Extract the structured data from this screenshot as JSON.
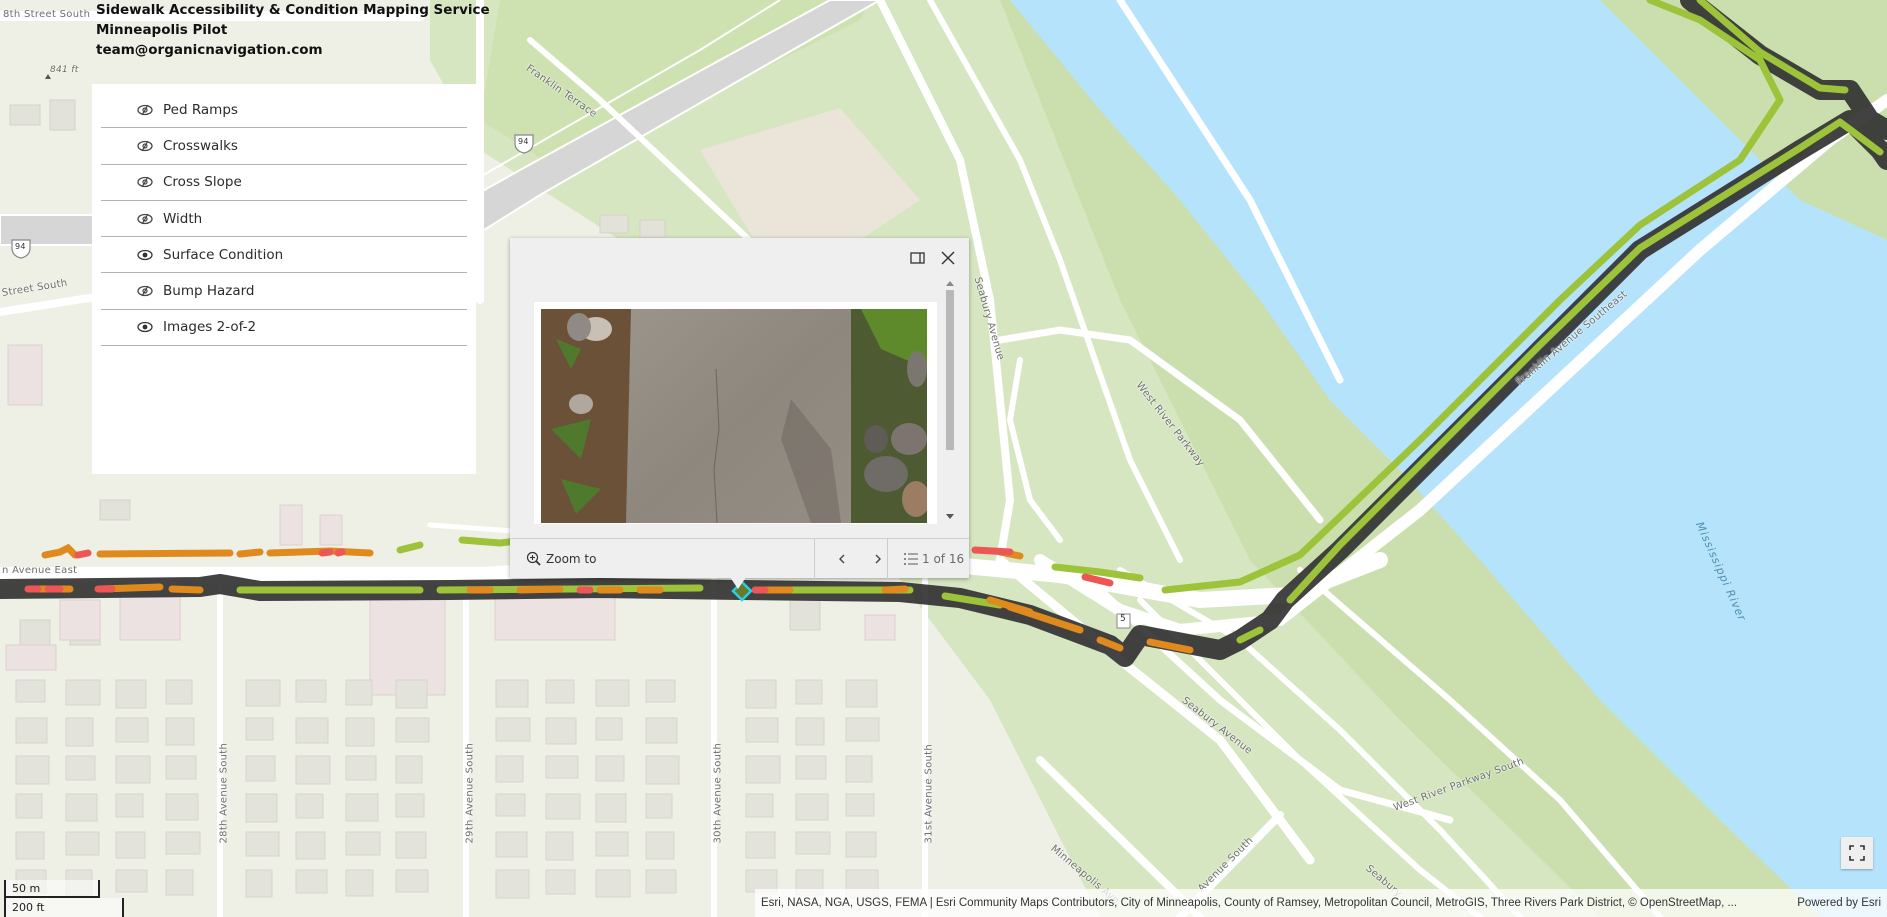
{
  "header": {
    "title": "Sidewalk Accessibility & Condition Mapping Service",
    "subtitle": "Minneapolis Pilot",
    "contact": "team@organicnavigation.com"
  },
  "layers": [
    {
      "label": "Ped Ramps",
      "visible": false
    },
    {
      "label": "Crosswalks",
      "visible": false
    },
    {
      "label": "Cross Slope",
      "visible": false
    },
    {
      "label": "Width",
      "visible": false
    },
    {
      "label": "Surface Condition",
      "visible": true
    },
    {
      "label": "Bump Hazard",
      "visible": false
    },
    {
      "label": "Images 2-of-2",
      "visible": true
    }
  ],
  "popup": {
    "dock_icon": "dock-side-icon",
    "close_icon": "close-icon",
    "image_alt": "Sidewalk surface photo",
    "zoom_to_label": "Zoom to",
    "prev_icon": "chevron-left-icon",
    "next_icon": "chevron-right-icon",
    "feature_count": "1 of 16"
  },
  "map": {
    "labels": {
      "street_8th": "8th Street South",
      "street_south_left": "Street South",
      "franklin_terrace": "Franklin Terrace",
      "seabury_ave_north": "Seabury Avenue",
      "west_river_pkwy": "West River Parkway",
      "franklin_ave_se": "Franklin Avenue Southeast",
      "mississippi": "Mississippi River",
      "franklin_ave_east": "n Avenue East",
      "seabury_ave_south": "Seabury Avenue",
      "west_river_pkwy_south": "West River Parkway South",
      "ave_28": "28th Avenue South",
      "ave_29": "29th Avenue South",
      "ave_30": "30th Avenue South",
      "ave_31": "31st Avenue South",
      "minneapolis_ave": "Minneapolis Ave",
      "ave_south_diag": "Avenue South",
      "seabury_bottom": "Seabury",
      "elevation": "841 ft",
      "i94_shield": "94",
      "route_5": "5"
    },
    "legend_colors": {
      "good": "#9dc33a",
      "fair": "#e08a1e",
      "poor": "#ee5656",
      "water": "#b5e3fb",
      "park": "#cfe1b4",
      "selection": "#22d3e0"
    }
  },
  "scalebar": {
    "metric": "50 m",
    "imperial": "200 ft"
  },
  "attribution": {
    "sources": "Esri, NASA, NGA, USGS, FEMA | Esri Community Maps Contributors, City of Minneapolis, County of Ramsey, Metropolitan Council, MetroGIS, Three Rivers Park District, © OpenStreetMap, ...",
    "powered_by": "Powered by Esri"
  },
  "controls": {
    "fullscreen_icon": "fullscreen-icon"
  }
}
